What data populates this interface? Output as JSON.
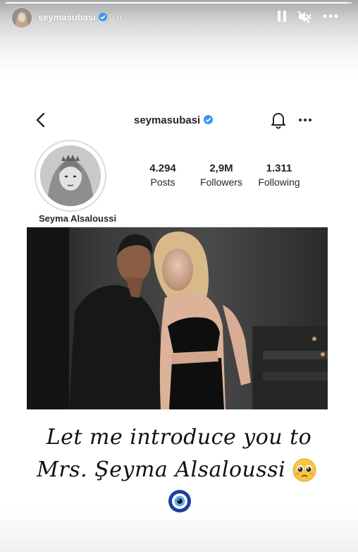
{
  "story": {
    "username": "seymasubasi",
    "time": "9 ч.",
    "progress": 0.99
  },
  "profile": {
    "username": "seymasubasi",
    "display_name": "Seyma Alsaloussi",
    "stats": [
      {
        "value": "4.294",
        "label": "Posts"
      },
      {
        "value": "2,9M",
        "label": "Followers"
      },
      {
        "value": "1.311",
        "label": "Following"
      }
    ]
  },
  "caption": {
    "line1": "Let me introduce you to",
    "line2": "Mrs. Şeyma Alsaloussi !"
  },
  "icons": {
    "story_controls": [
      "pause-icon",
      "mute-icon",
      "more-icon"
    ],
    "profile_nav": [
      "back-icon",
      "bell-icon",
      "more-options-icon"
    ],
    "emoji": [
      "pleading-face-emoji",
      "evil-eye-emoji"
    ]
  },
  "colors": {
    "verified": "#3897f0",
    "text": "#262626",
    "evil_eye": "#1f3f9e"
  }
}
